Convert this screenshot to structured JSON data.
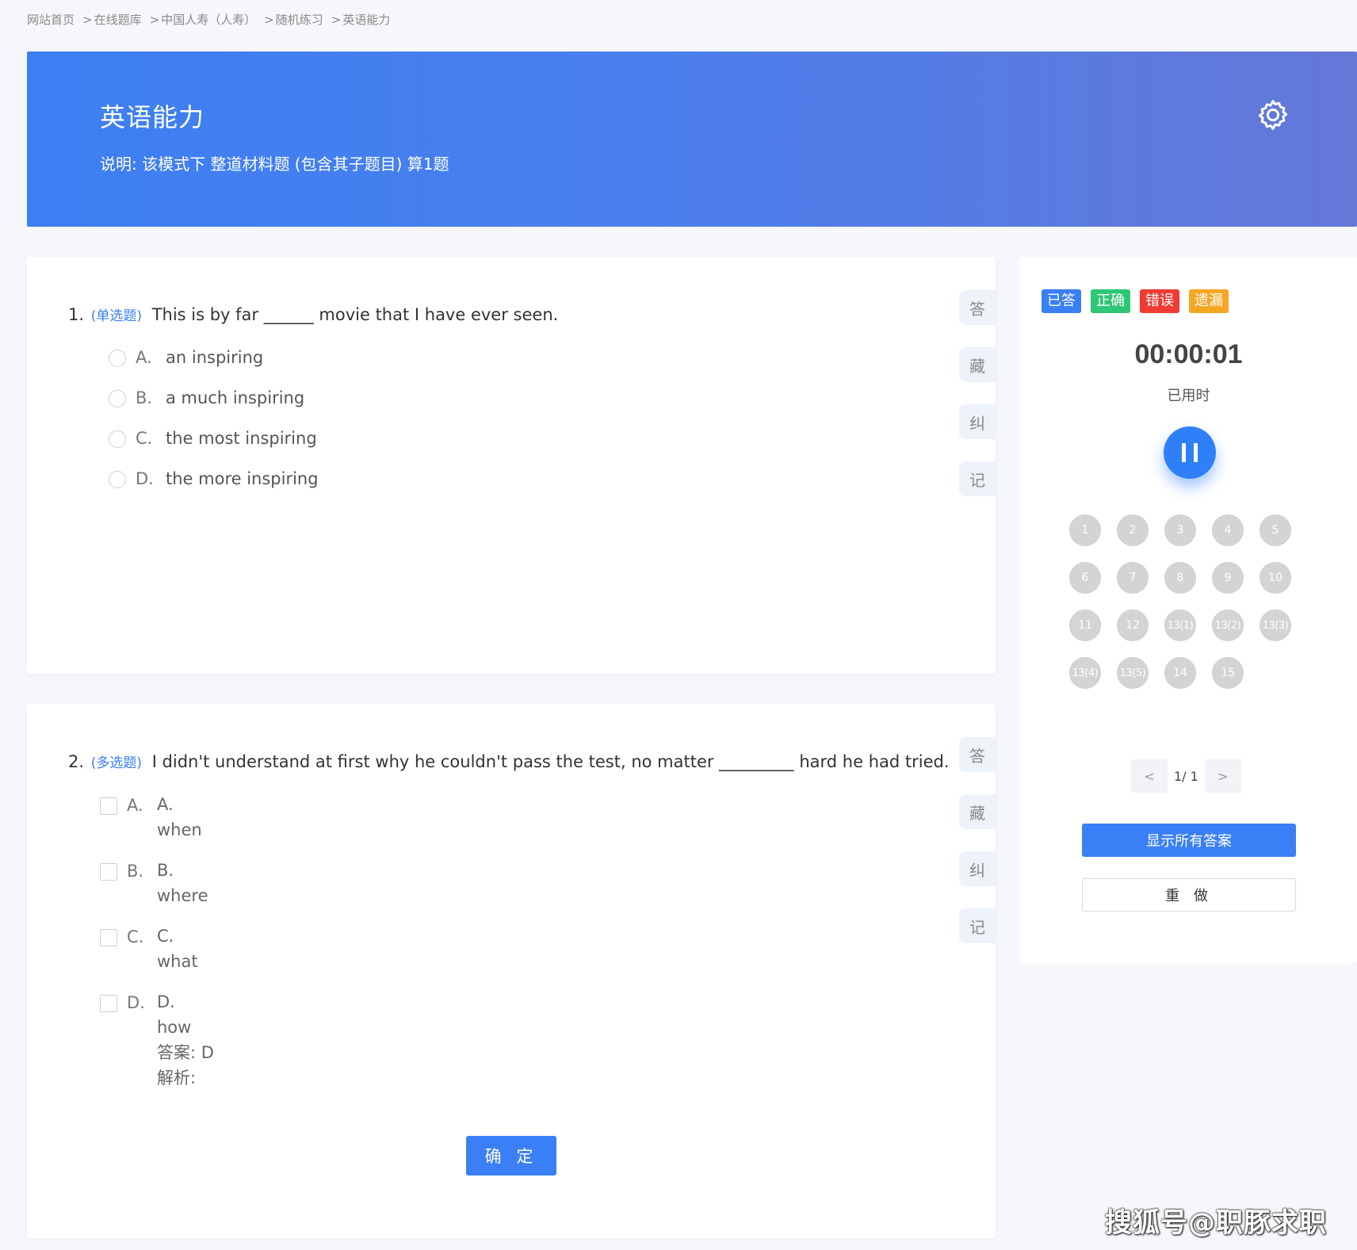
{
  "breadcrumb": [
    {
      "label": "网站首页"
    },
    {
      "label": "在线题库"
    },
    {
      "label": "中国人寿（人寿）"
    },
    {
      "label": "随机练习"
    },
    {
      "label": "英语能力"
    }
  ],
  "banner": {
    "title": "英语能力",
    "description": "说明:  该模式下 整道材料题 (包含其子题目) 算1题",
    "settings_icon": "gear-icon"
  },
  "side_buttons": [
    "答",
    "藏",
    "纠",
    "记"
  ],
  "question1": {
    "number": "1.",
    "type": "(单选题)",
    "stem": "This is by far ______ movie that I have ever seen.",
    "options": [
      {
        "letter": "A.",
        "text": "an inspiring"
      },
      {
        "letter": "B.",
        "text": "a much inspiring"
      },
      {
        "letter": "C.",
        "text": "the most inspiring"
      },
      {
        "letter": "D.",
        "text": "the more inspiring"
      }
    ]
  },
  "question2": {
    "number": "2.",
    "type": "(多选题)",
    "stem": "I didn't understand at first why he couldn't pass the test, no matter _________ hard he had tried.",
    "options": [
      {
        "letter": "A.",
        "label": "A.",
        "text": "when"
      },
      {
        "letter": "B.",
        "label": "B.",
        "text": "where"
      },
      {
        "letter": "C.",
        "label": "C.",
        "text": "what"
      },
      {
        "letter": "D.",
        "label": "D.",
        "text": "how"
      }
    ],
    "answer": "答案: D",
    "analysis": "解析:",
    "confirm_label": "确 定"
  },
  "panel": {
    "legend": [
      {
        "label": "已答",
        "color": "#3a7ff6"
      },
      {
        "label": "正确",
        "color": "#2ec775"
      },
      {
        "label": "错误",
        "color": "#ee3b33"
      },
      {
        "label": "遗漏",
        "color": "#f5a623"
      }
    ],
    "timer": "00:00:01",
    "timer_label": "已用时",
    "pause_icon": "pause-icon",
    "numbers": [
      "1",
      "2",
      "3",
      "4",
      "5",
      "6",
      "7",
      "8",
      "9",
      "10",
      "11",
      "12",
      "13(1)",
      "13(2)",
      "13(3)",
      "13(4)",
      "13(5)",
      "14",
      "15"
    ],
    "pager": {
      "prev": "<",
      "info": "1/ 1",
      "next": ">"
    },
    "show_all_label": "显示所有答案",
    "redo_label": "重 做"
  },
  "watermark": "搜狐号@职豚求职"
}
